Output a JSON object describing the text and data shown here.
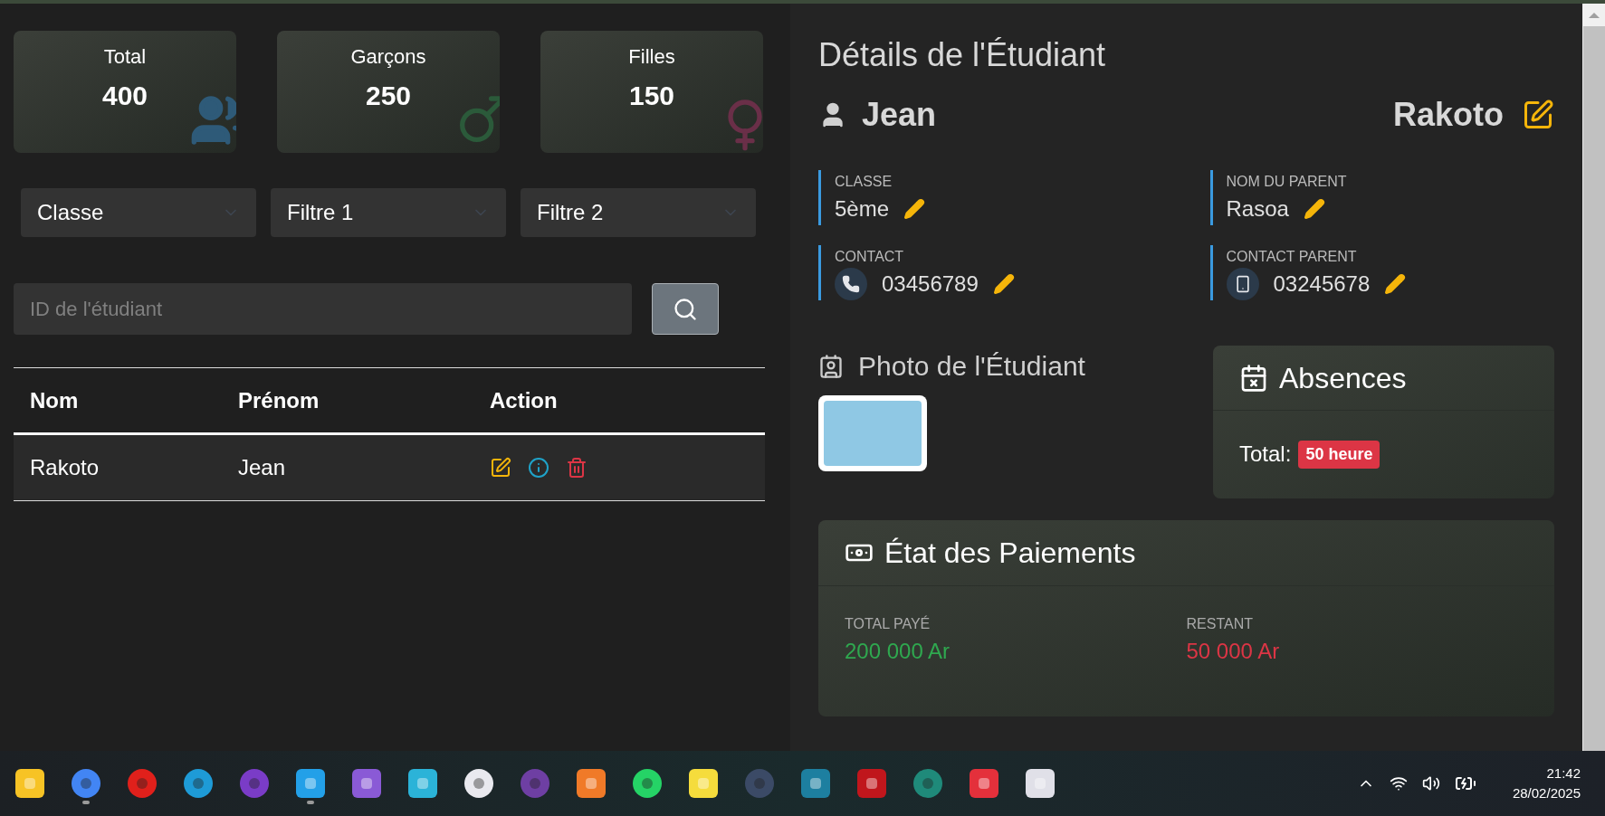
{
  "stats": [
    {
      "label": "Total",
      "value": "400",
      "kind": "total"
    },
    {
      "label": "Garçons",
      "value": "250",
      "kind": "male"
    },
    {
      "label": "Filles",
      "value": "150",
      "kind": "female"
    }
  ],
  "filters": [
    "Classe",
    "Filtre 1",
    "Filtre 2"
  ],
  "search": {
    "placeholder": "ID de l'étudiant"
  },
  "table": {
    "columns": [
      "Nom",
      "Prénom",
      "Action"
    ],
    "rows": [
      {
        "cells": [
          "Rakoto",
          "Jean"
        ]
      }
    ]
  },
  "details": {
    "title": "Détails de l'Étudiant",
    "first_name": "Jean",
    "last_name": "Rakoto",
    "fields": [
      {
        "label": "CLASSE",
        "value": "5ème",
        "kind": "plain"
      },
      {
        "label": "NOM DU PARENT",
        "value": "Rasoa",
        "kind": "plain"
      },
      {
        "label": "CONTACT",
        "value": "03456789",
        "kind": "phone"
      },
      {
        "label": "CONTACT PARENT",
        "value": "03245678",
        "kind": "mobile"
      }
    ],
    "photo_title": "Photo de l'Étudiant",
    "absences": {
      "title": "Absences",
      "label": "Total:",
      "badge": "50 heure"
    },
    "payments": {
      "title": "État des Paiements",
      "items": [
        {
          "label": "TOTAL PAYÉ",
          "value": "200 000 Ar",
          "kind": "paid"
        },
        {
          "label": "RESTANT",
          "value": "50 000 Ar",
          "kind": "due"
        }
      ]
    }
  },
  "taskbar": {
    "apps": [
      {
        "running": false
      },
      {
        "running": true
      },
      {
        "running": false
      },
      {
        "running": false
      },
      {
        "running": false
      },
      {
        "running": true
      },
      {
        "running": false
      },
      {
        "running": false
      },
      {
        "running": false
      },
      {
        "running": false
      },
      {
        "running": false
      },
      {
        "running": false
      },
      {
        "running": false
      },
      {
        "running": false
      },
      {
        "running": false
      },
      {
        "running": false
      },
      {
        "running": false
      },
      {
        "running": false
      },
      {
        "running": false
      }
    ],
    "time": "21:42",
    "date": "28/02/2025"
  }
}
